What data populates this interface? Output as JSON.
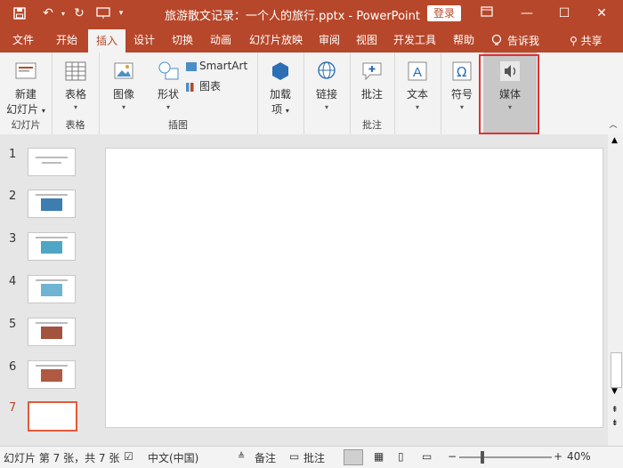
{
  "window": {
    "title": "旅游散文记录：一个人的旅行.pptx  -  PowerPoint",
    "login_label": "登录"
  },
  "tabs": [
    "文件",
    "开始",
    "插入",
    "设计",
    "切换",
    "动画",
    "幻灯片放映",
    "审阅",
    "视图",
    "开发工具",
    "帮助"
  ],
  "active_tab": "插入",
  "tell_me": "告诉我",
  "share": "共享",
  "ribbon": {
    "groups": {
      "slides": {
        "label": "幻灯片",
        "new_slide": "新建",
        "new_slide2": "幻灯片"
      },
      "tables": {
        "label": "表格",
        "table": "表格"
      },
      "illustrations": {
        "label": "插图",
        "images": "图像",
        "shapes": "形状",
        "smartart": "SmartArt",
        "chart": "图表"
      },
      "addins": {
        "label": "",
        "addins": "加载",
        "addins2": "项"
      },
      "links": {
        "label": "",
        "link": "链接"
      },
      "comments": {
        "label": "批注",
        "comment": "批注"
      },
      "text": {
        "label": "",
        "text": "文本"
      },
      "symbols": {
        "label": "",
        "symbol": "符号"
      },
      "media": {
        "label": "",
        "media": "媒体"
      }
    }
  },
  "slides": [
    {
      "num": "1"
    },
    {
      "num": "2"
    },
    {
      "num": "3"
    },
    {
      "num": "4"
    },
    {
      "num": "5"
    },
    {
      "num": "6"
    },
    {
      "num": "7"
    }
  ],
  "current_slide": "7",
  "status": {
    "slide_info": "幻灯片 第 7 张，共 7 张",
    "language": "中文(中国)",
    "notes": "备注",
    "comments": "批注",
    "zoom": "40%"
  },
  "colors": {
    "accent": "#b7472a",
    "highlight": "#e03232"
  }
}
